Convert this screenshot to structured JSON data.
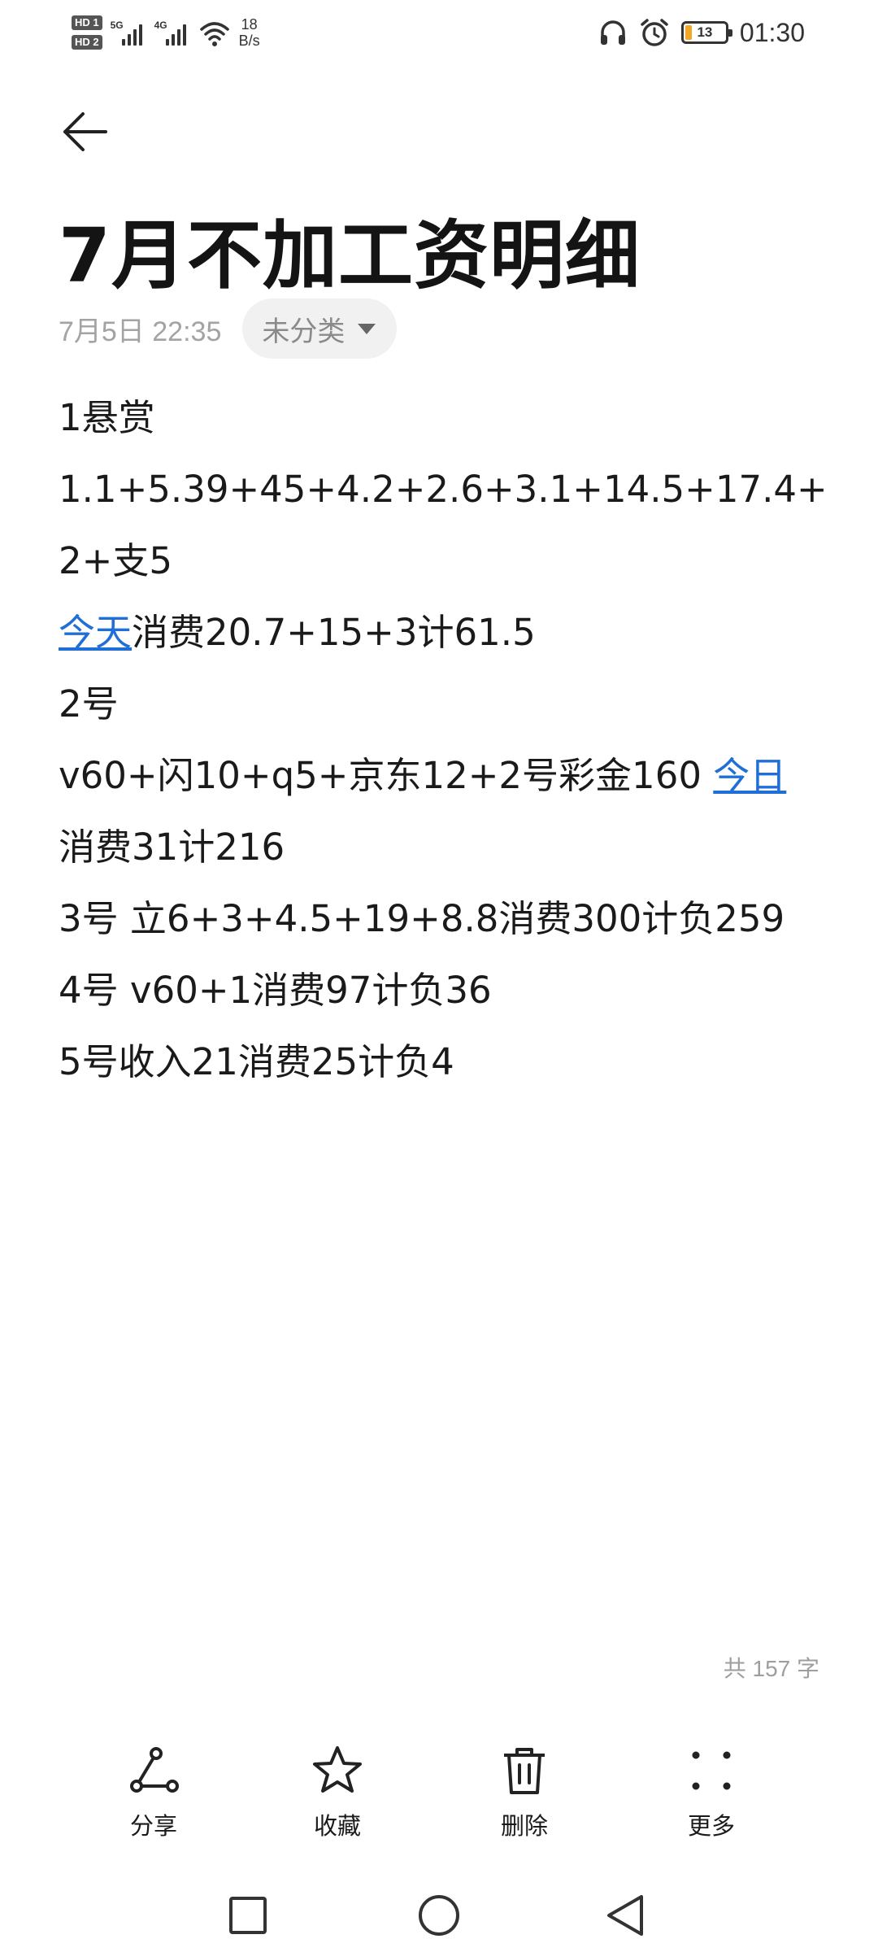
{
  "status_bar": {
    "sim1": "HD 1",
    "sim2": "HD 2",
    "net1": "5G",
    "net2": "4G",
    "speed_value": "18",
    "speed_unit": "B/s",
    "battery_level": "13",
    "time": "01:30",
    "icons": [
      "headphones-icon",
      "alarm-icon",
      "battery-icon",
      "wifi-icon",
      "signal-icon"
    ]
  },
  "header": {
    "back_icon": "arrow-left-icon",
    "title": "7月不加工资明细",
    "date": "7月5日 22:35",
    "category": "未分类"
  },
  "note": {
    "line1": "1悬赏",
    "line2": "1.1+5.39+45+4.2+2.6+3.1+14.5+17.4+2+支5",
    "line3_link": "今天",
    "line3_rest": "消费20.7+15+3计61.5",
    "line4": "2号",
    "line5_start": "v60+闪10+q5+京东12+2号彩金160 ",
    "line5_link": "今日",
    "line5_end": " 消费31计216",
    "line6": "3号  立6+3+4.5+19+8.8消费300计负259",
    "line7": "4号  v60+1消费97计负36",
    "line8": "5号收入21消费25计负4"
  },
  "word_count": "共 157 字",
  "toolbar": {
    "share": "分享",
    "favorite": "收藏",
    "delete": "删除",
    "more": "更多"
  },
  "colors": {
    "link": "#1f6fd6",
    "meta_text": "#a3a3a3",
    "chip_bg": "#f1f1f1",
    "battery_low": "#f5a623"
  }
}
